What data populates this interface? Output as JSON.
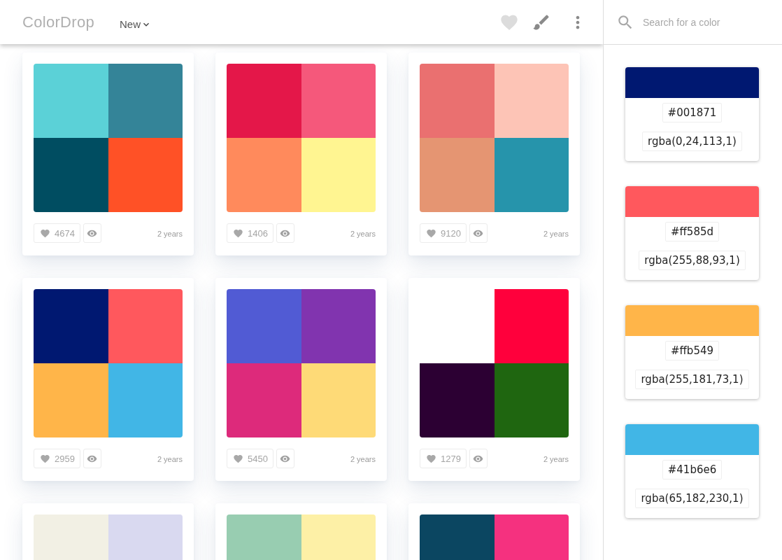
{
  "header": {
    "logo": "ColorDrop",
    "sort_menu": {
      "label": "New"
    }
  },
  "search": {
    "placeholder": "Search for a color"
  },
  "palettes": [
    {
      "swatches": [
        {
          "color": "#5bd1d7"
        },
        {
          "color": "#348498"
        },
        {
          "color": "#004d61"
        },
        {
          "color": "#ff5126"
        }
      ],
      "likes": "4674",
      "age": "2 years"
    },
    {
      "swatches": [
        {
          "color": "#e41749"
        },
        {
          "color": "#f5587b"
        },
        {
          "color": "#ff8a5c"
        },
        {
          "color": "#fff591"
        }
      ],
      "likes": "1406",
      "age": "2 years"
    },
    {
      "swatches": [
        {
          "color": "#ea7070"
        },
        {
          "color": "#fdc4b6"
        },
        {
          "color": "#e59572"
        },
        {
          "color": "#2694ab"
        }
      ],
      "likes": "9120",
      "age": "2 years"
    },
    {
      "swatches": [
        {
          "color": "#001871"
        },
        {
          "color": "#ff585d"
        },
        {
          "color": "#ffb549"
        },
        {
          "color": "#41b6e6"
        }
      ],
      "likes": "2959",
      "age": "2 years"
    },
    {
      "swatches": [
        {
          "color": "#515bd4"
        },
        {
          "color": "#8134af"
        },
        {
          "color": "#dd2a7b"
        },
        {
          "color": "#feda77"
        }
      ],
      "likes": "5450",
      "age": "2 years"
    },
    {
      "swatches": [
        {
          "color": "#ffffff"
        },
        {
          "color": "#ff003c"
        },
        {
          "color": "#2c0033"
        },
        {
          "color": "#1f6610"
        }
      ],
      "likes": "1279",
      "age": "2 years"
    },
    {
      "swatches": [
        {
          "color": "#f2f0e4"
        },
        {
          "color": "#d9d9f0"
        }
      ]
    },
    {
      "swatches": [
        {
          "color": "#98cdb1"
        },
        {
          "color": "#fdf0a6"
        }
      ]
    },
    {
      "swatches": [
        {
          "color": "#0b4661"
        },
        {
          "color": "#f5317f"
        }
      ]
    }
  ],
  "selected_colors": [
    {
      "color": "#001871",
      "hex": "#001871",
      "rgba": "rgba(0,24,113,1)"
    },
    {
      "color": "#ff585d",
      "hex": "#ff585d",
      "rgba": "rgba(255,88,93,1)"
    },
    {
      "color": "#ffb549",
      "hex": "#ffb549",
      "rgba": "rgba(255,181,73,1)"
    },
    {
      "color": "#41b6e6",
      "hex": "#41b6e6",
      "rgba": "rgba(65,182,230,1)"
    }
  ]
}
